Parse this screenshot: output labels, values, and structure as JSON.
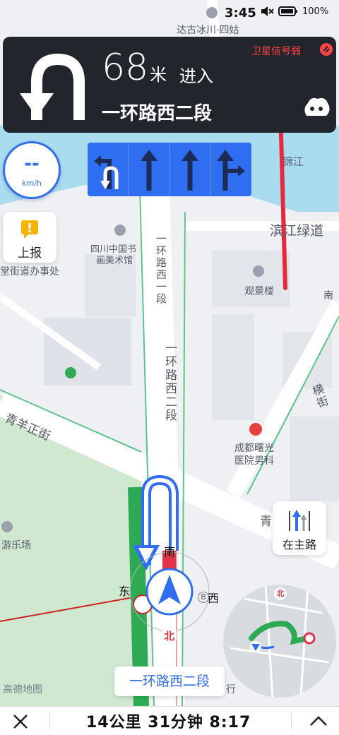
{
  "status_bar": {
    "time": "3:45",
    "battery": "100",
    "battery_suffix": "%",
    "icons": [
      "location-pin-icon",
      "mute-icon",
      "battery-icon"
    ]
  },
  "navigation": {
    "distance_value": "68",
    "distance_unit": "米",
    "action": "进入",
    "road_name": "一环路西二段",
    "signal_warning": "卫星信号弱",
    "maneuver_icon": "u-turn-icon",
    "accent_color": "#2f6ef0",
    "warning_color": "#ff4444"
  },
  "lanes": [
    "u-turn-left-lane",
    "straight-lane",
    "straight-lane",
    "straight-right-lane"
  ],
  "speed": {
    "value": "--",
    "unit": "km/h"
  },
  "report_button": {
    "label": "上报"
  },
  "main_road_button": {
    "label": "在主路"
  },
  "map_labels": {
    "top_poi": "达古冰川·四姑",
    "east_road": "锦江",
    "riverside": "滨江绿道",
    "art_museum_line1": "四川中国书",
    "art_museum_line2": "画美术馆",
    "subdistrict": "堂街道办事处",
    "guanjing": "观景楼",
    "nan": "南",
    "yihuan_upper": "一环路西一段",
    "yihuan_lower": "一环路西二段",
    "qingyang": "青羊正街",
    "hospital_line1": "成都曙光",
    "hospital_line2": "医院男科",
    "heng": "横街",
    "qing": "青",
    "amusement": "游乐场",
    "xing": "行",
    "compass_south": "南",
    "compass_east": "东",
    "compass_west": "西",
    "compass_north": "北",
    "bus_letter": "B",
    "watermark": "高德地图"
  },
  "current_road": "一环路西二段",
  "trip": {
    "summary": "14公里 31分钟 8:17"
  },
  "bottom_bar": {
    "close_icon": "close-icon",
    "expand_icon": "chevron-up-icon"
  }
}
